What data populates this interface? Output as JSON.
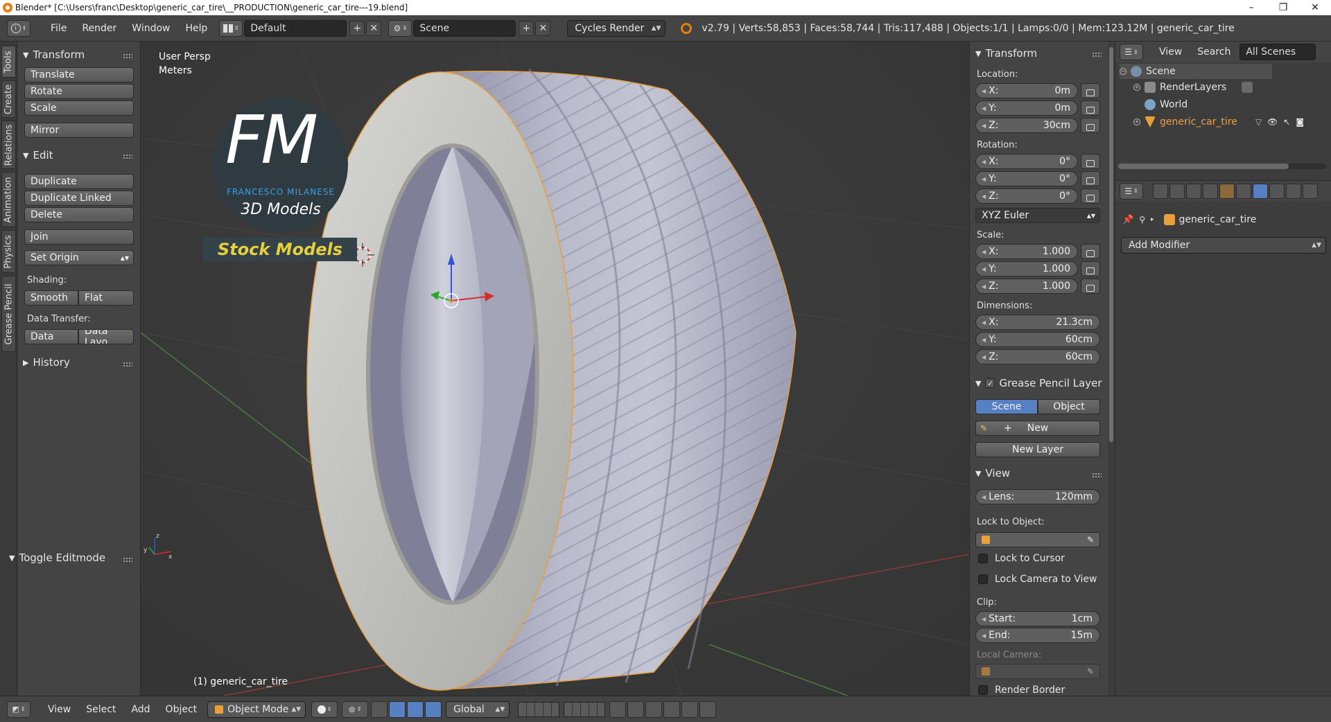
{
  "window": {
    "title": "Blender* [C:\\Users\\franc\\Desktop\\generic_car_tire\\__PRODUCTION\\generic_car_tire---19.blend]",
    "minimize": "–",
    "maximize": "❐",
    "close": "✕"
  },
  "info_header": {
    "menus": [
      "File",
      "Render",
      "Window",
      "Help"
    ],
    "layout": "Default",
    "scene": "Scene",
    "engine": "Cycles Render",
    "stats": "v2.79 | Verts:58,853 | Faces:58,744 | Tris:117,488 | Objects:1/1 | Lamps:0/0 | Mem:123.12M | generic_car_tire"
  },
  "tabs": [
    "Tools",
    "Create",
    "Relations",
    "Animation",
    "Physics",
    "Grease Pencil"
  ],
  "toolshelf": {
    "transform": {
      "title": "Transform",
      "buttons": [
        "Translate",
        "Rotate",
        "Scale",
        "Mirror"
      ]
    },
    "edit": {
      "title": "Edit",
      "buttons": [
        "Duplicate",
        "Duplicate Linked",
        "Delete",
        "Join"
      ],
      "set_origin": "Set Origin",
      "shading_label": "Shading:",
      "smooth": "Smooth",
      "flat": "Flat",
      "data_transfer_label": "Data Transfer:",
      "data": "Data",
      "data_layout": "Data Layo"
    },
    "history": "History",
    "toggle_editmode": "Toggle Editmode"
  },
  "viewport": {
    "view_name": "User Persp",
    "units": "Meters",
    "object_label": "(1) generic_car_tire",
    "logo": {
      "letters": "FM",
      "name": "FRANCESCO MILANESE",
      "tagline": "3D Models",
      "banner": "Stock Models"
    }
  },
  "npanel": {
    "transform_title": "Transform",
    "location_label": "Location:",
    "location": [
      {
        "axis": "X:",
        "value": "0m"
      },
      {
        "axis": "Y:",
        "value": "0m"
      },
      {
        "axis": "Z:",
        "value": "30cm"
      }
    ],
    "rotation_label": "Rotation:",
    "rotation": [
      {
        "axis": "X:",
        "value": "0°"
      },
      {
        "axis": "Y:",
        "value": "0°"
      },
      {
        "axis": "Z:",
        "value": "0°"
      }
    ],
    "rotation_mode": "XYZ Euler",
    "scale_label": "Scale:",
    "scale": [
      {
        "axis": "X:",
        "value": "1.000"
      },
      {
        "axis": "Y:",
        "value": "1.000"
      },
      {
        "axis": "Z:",
        "value": "1.000"
      }
    ],
    "dimensions_label": "Dimensions:",
    "dimensions": [
      {
        "axis": "X:",
        "value": "21.3cm"
      },
      {
        "axis": "Y:",
        "value": "60cm"
      },
      {
        "axis": "Z:",
        "value": "60cm"
      }
    ],
    "grease_title": "Grease Pencil Layer",
    "grease_scene": "Scene",
    "grease_object": "Object",
    "grease_new": "New",
    "grease_new_layer": "New Layer",
    "view_title": "View",
    "lens_label": "Lens:",
    "lens_value": "120mm",
    "lock_to_object": "Lock to Object:",
    "lock_to_cursor": "Lock to Cursor",
    "lock_camera": "Lock Camera to View",
    "clip_label": "Clip:",
    "clip_start_label": "Start:",
    "clip_start": "1cm",
    "clip_end_label": "End:",
    "clip_end": "15m",
    "local_camera": "Local Camera:",
    "render_border": "Render Border"
  },
  "outliner": {
    "menus": [
      "View",
      "Search"
    ],
    "filter": "All Scenes",
    "items": [
      "Scene",
      "RenderLayers",
      "World",
      "generic_car_tire"
    ]
  },
  "properties": {
    "object_name": "generic_car_tire",
    "add_modifier": "Add Modifier"
  },
  "bottom_header": {
    "menus": [
      "View",
      "Select",
      "Add",
      "Object"
    ],
    "mode": "Object Mode",
    "orientation": "Global"
  },
  "colors": {
    "accent_blue": "#5680c2",
    "selection_orange": "#e9a03b",
    "logo_text_yellow": "#e8cf3c",
    "logo_blue": "#3d9fe0"
  }
}
